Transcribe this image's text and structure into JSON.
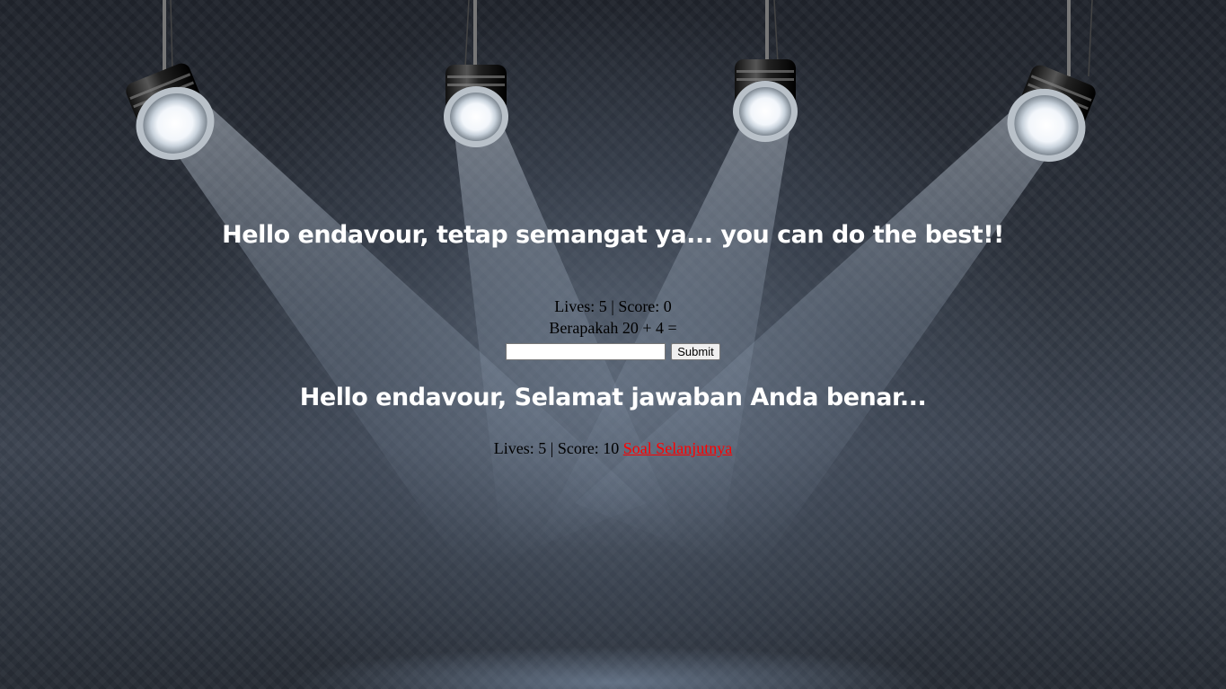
{
  "greeting": "Hello endavour, tetap semangat ya... you can do the best!!",
  "game": {
    "lives_label": "Lives:",
    "lives": "5",
    "separator": "|",
    "score_label": "Score:",
    "score_before": "0",
    "question": "Berapakah 20 + 4 =",
    "answer_value": "",
    "submit_label": "Submit"
  },
  "result": {
    "message": "Hello endavour, Selamat jawaban Anda benar...",
    "score_after": "10",
    "next_link_label": "Soal Selanjutnya",
    "link_color": "#ff0000"
  },
  "icons": [
    "spotlight-icon",
    "spotlight-icon",
    "spotlight-icon",
    "spotlight-icon"
  ],
  "colors": {
    "heading_text": "#ffffff",
    "body_text": "#000000",
    "background": "#2d333d"
  }
}
